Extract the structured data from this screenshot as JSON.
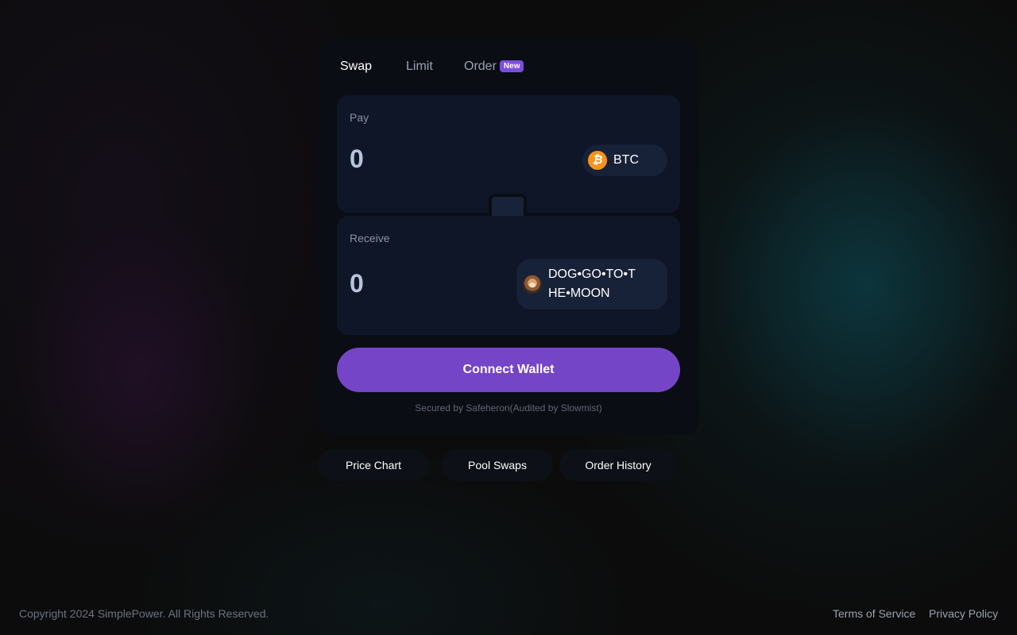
{
  "tabs": [
    {
      "label": "Swap",
      "active": true
    },
    {
      "label": "Limit",
      "active": false
    },
    {
      "label": "Order",
      "active": false,
      "badge": "New"
    }
  ],
  "pay": {
    "label": "Pay",
    "amount": "0",
    "token": {
      "symbol": "BTC",
      "icon": "bitcoin-icon",
      "icon_glyph": "₿",
      "color": "#f7931a"
    }
  },
  "swap_direction_icon": "swap-arrows-icon",
  "receive": {
    "label": "Receive",
    "amount": "0",
    "token": {
      "symbol": "DOG•GO•TO•THE•MOON",
      "icon": "dog-token-icon"
    }
  },
  "connect_button": {
    "label": "Connect Wallet",
    "color": "#7545c8"
  },
  "secured_text": "Secured by Safeheron(Audited by Slowmist)",
  "bottom_nav": [
    {
      "label": "Price Chart"
    },
    {
      "label": "Pool Swaps"
    },
    {
      "label": "Order History"
    }
  ],
  "footer": {
    "copyright": "Copyright 2024 SimplePower. All Rights Reserved.",
    "links": [
      "Terms of Service",
      "Privacy Policy"
    ]
  },
  "colors": {
    "accent": "#7c4dde",
    "background": "#0c0c0c",
    "card": "#0a0d13",
    "panel": "#0f1628"
  }
}
